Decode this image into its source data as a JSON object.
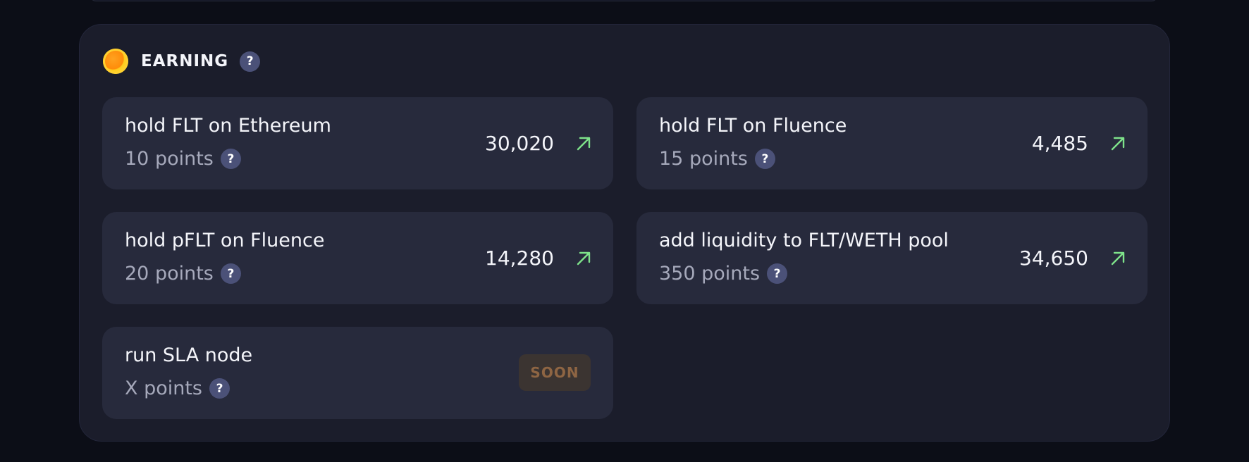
{
  "section": {
    "title": "EARNING",
    "help": "?",
    "icon": "coin-icon"
  },
  "cards": [
    {
      "title": "hold FLT on Ethereum",
      "points": "10 points",
      "value": "30,020",
      "help": "?",
      "icon": "arrow-up-right-icon"
    },
    {
      "title": "hold FLT on Fluence",
      "points": "15 points",
      "value": "4,485",
      "help": "?",
      "icon": "arrow-up-right-icon"
    },
    {
      "title": "hold pFLT on Fluence",
      "points": "20 points",
      "value": "14,280",
      "help": "?",
      "icon": "arrow-up-right-icon"
    },
    {
      "title": "add liquidity to FLT/WETH pool",
      "points": "350 points",
      "value": "34,650",
      "help": "?",
      "icon": "arrow-up-right-icon"
    },
    {
      "title": "run SLA node",
      "points": "X points",
      "badge": "SOON",
      "help": "?"
    }
  ],
  "colors": {
    "background": "#0c0e17",
    "panel": "#1b1d2b",
    "card": "#272a3c",
    "arrow": "#7ee28a",
    "help_badge": "#4b5178",
    "soon_bg": "#3b3431",
    "soon_text": "#8e6543"
  }
}
